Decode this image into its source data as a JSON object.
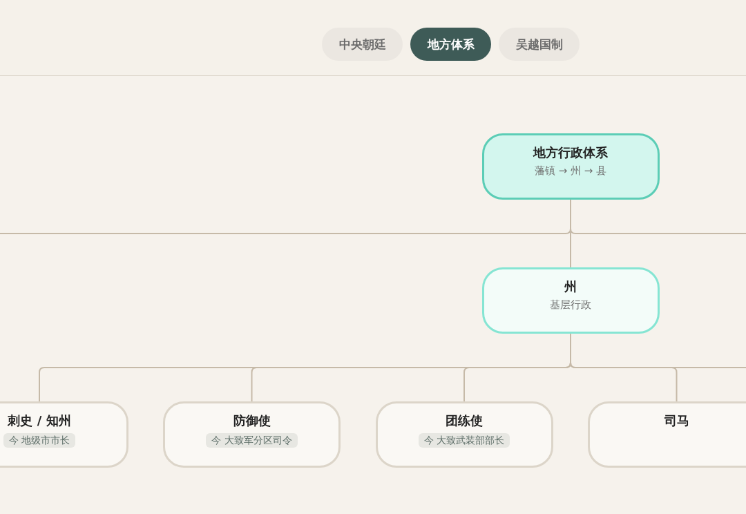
{
  "tabs": [
    {
      "label": "中央朝廷",
      "selected": false
    },
    {
      "label": "地方体系",
      "selected": true
    },
    {
      "label": "吴越国制",
      "selected": false
    }
  ],
  "tree": {
    "title": "地方行政体系",
    "subtitle": "藩镇 → 州 → 县",
    "continues_left": true,
    "continues_right": true,
    "children": [
      {
        "title": "州",
        "subtitle": "基层行政",
        "continues_right": true,
        "children": [
          {
            "title": "刺史 / 知州",
            "note": "今 地级市市长"
          },
          {
            "title": "防御使",
            "note": "今 大致军分区司令"
          },
          {
            "title": "团练使",
            "note": "今 大致武装部部长"
          },
          {
            "title": "司马"
          }
        ]
      }
    ]
  }
}
